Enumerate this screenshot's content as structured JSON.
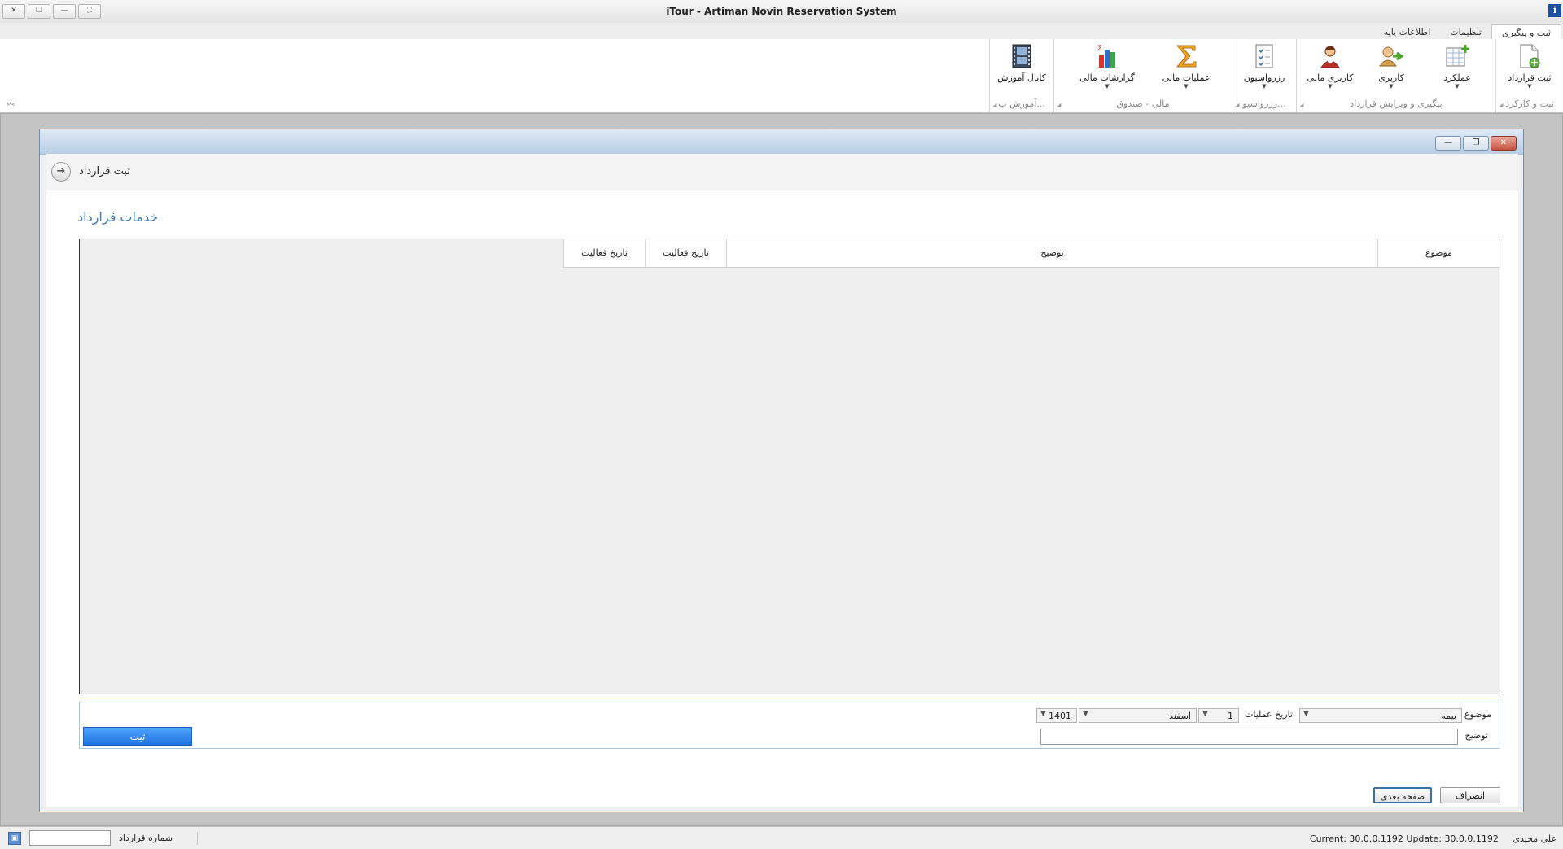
{
  "window": {
    "title": "iTour - Artiman Novin Reservation System",
    "app_icon": "i",
    "controls": [
      "close",
      "restore",
      "minimize",
      "fullscreen"
    ]
  },
  "tabs": [
    {
      "label": "ثبت و پیگیری",
      "active": true
    },
    {
      "label": "تنظیمات",
      "active": false
    },
    {
      "label": "اطلاعات پایه",
      "active": false
    }
  ],
  "ribbon": {
    "collapse_icon": "chevron-up-icon",
    "groups": [
      {
        "label": "ثبت و کارکرد",
        "buttons": [
          {
            "label": "ثبت قرارداد",
            "icon": "add-document-icon",
            "dropdown": true
          }
        ]
      },
      {
        "label": "پیگیری و ویرایش قرارداد",
        "buttons": [
          {
            "label": "عملکرد",
            "icon": "spreadsheet-icon",
            "dropdown": true
          },
          {
            "label": "کاربری",
            "icon": "user-icon",
            "dropdown": true
          },
          {
            "label": "کاربری مالی",
            "icon": "finance-user-icon",
            "dropdown": true
          }
        ]
      },
      {
        "label": "رزرواسیو...",
        "buttons": [
          {
            "label": "رزرواسیون",
            "icon": "checklist-icon",
            "dropdown": true
          }
        ]
      },
      {
        "label": "مالی - صندوق",
        "buttons": [
          {
            "label": "عملیات مالی",
            "icon": "sigma-icon",
            "dropdown": true
          },
          {
            "label": "گزارشات مالی",
            "icon": "bar-chart-icon",
            "dropdown": true
          }
        ]
      },
      {
        "label": "آموزش ب...",
        "buttons": [
          {
            "label": "کانال آموزش",
            "icon": "film-icon",
            "dropdown": false
          }
        ]
      }
    ]
  },
  "mdi": {
    "buttons": [
      "minimize",
      "restore",
      "close"
    ]
  },
  "page": {
    "nav_title": "ثبت قرارداد",
    "section_title": "خدمات قرارداد",
    "grid": {
      "columns": [
        "موضوع",
        "توضیح",
        "تاریخ فعالیت",
        "تاریخ فعالیت"
      ],
      "rows": []
    },
    "form": {
      "subject_label": "موضوع",
      "subject_value": "بیمه",
      "date_label": "تاریخ عملیات",
      "day_value": "1",
      "month_value": "اسفند",
      "year_value": "1401",
      "description_label": "توضیح",
      "description_value": "",
      "submit_label": "ثبت"
    },
    "footer": {
      "cancel_label": "انصراف",
      "next_label": "صفحه بعدی"
    }
  },
  "statusbar": {
    "user": "علی مجیدی",
    "version": "Current: 30.0.0.1192 Update: 30.0.0.1192",
    "contract_number_label": "شماره قرارداد",
    "contract_number_value": ""
  }
}
